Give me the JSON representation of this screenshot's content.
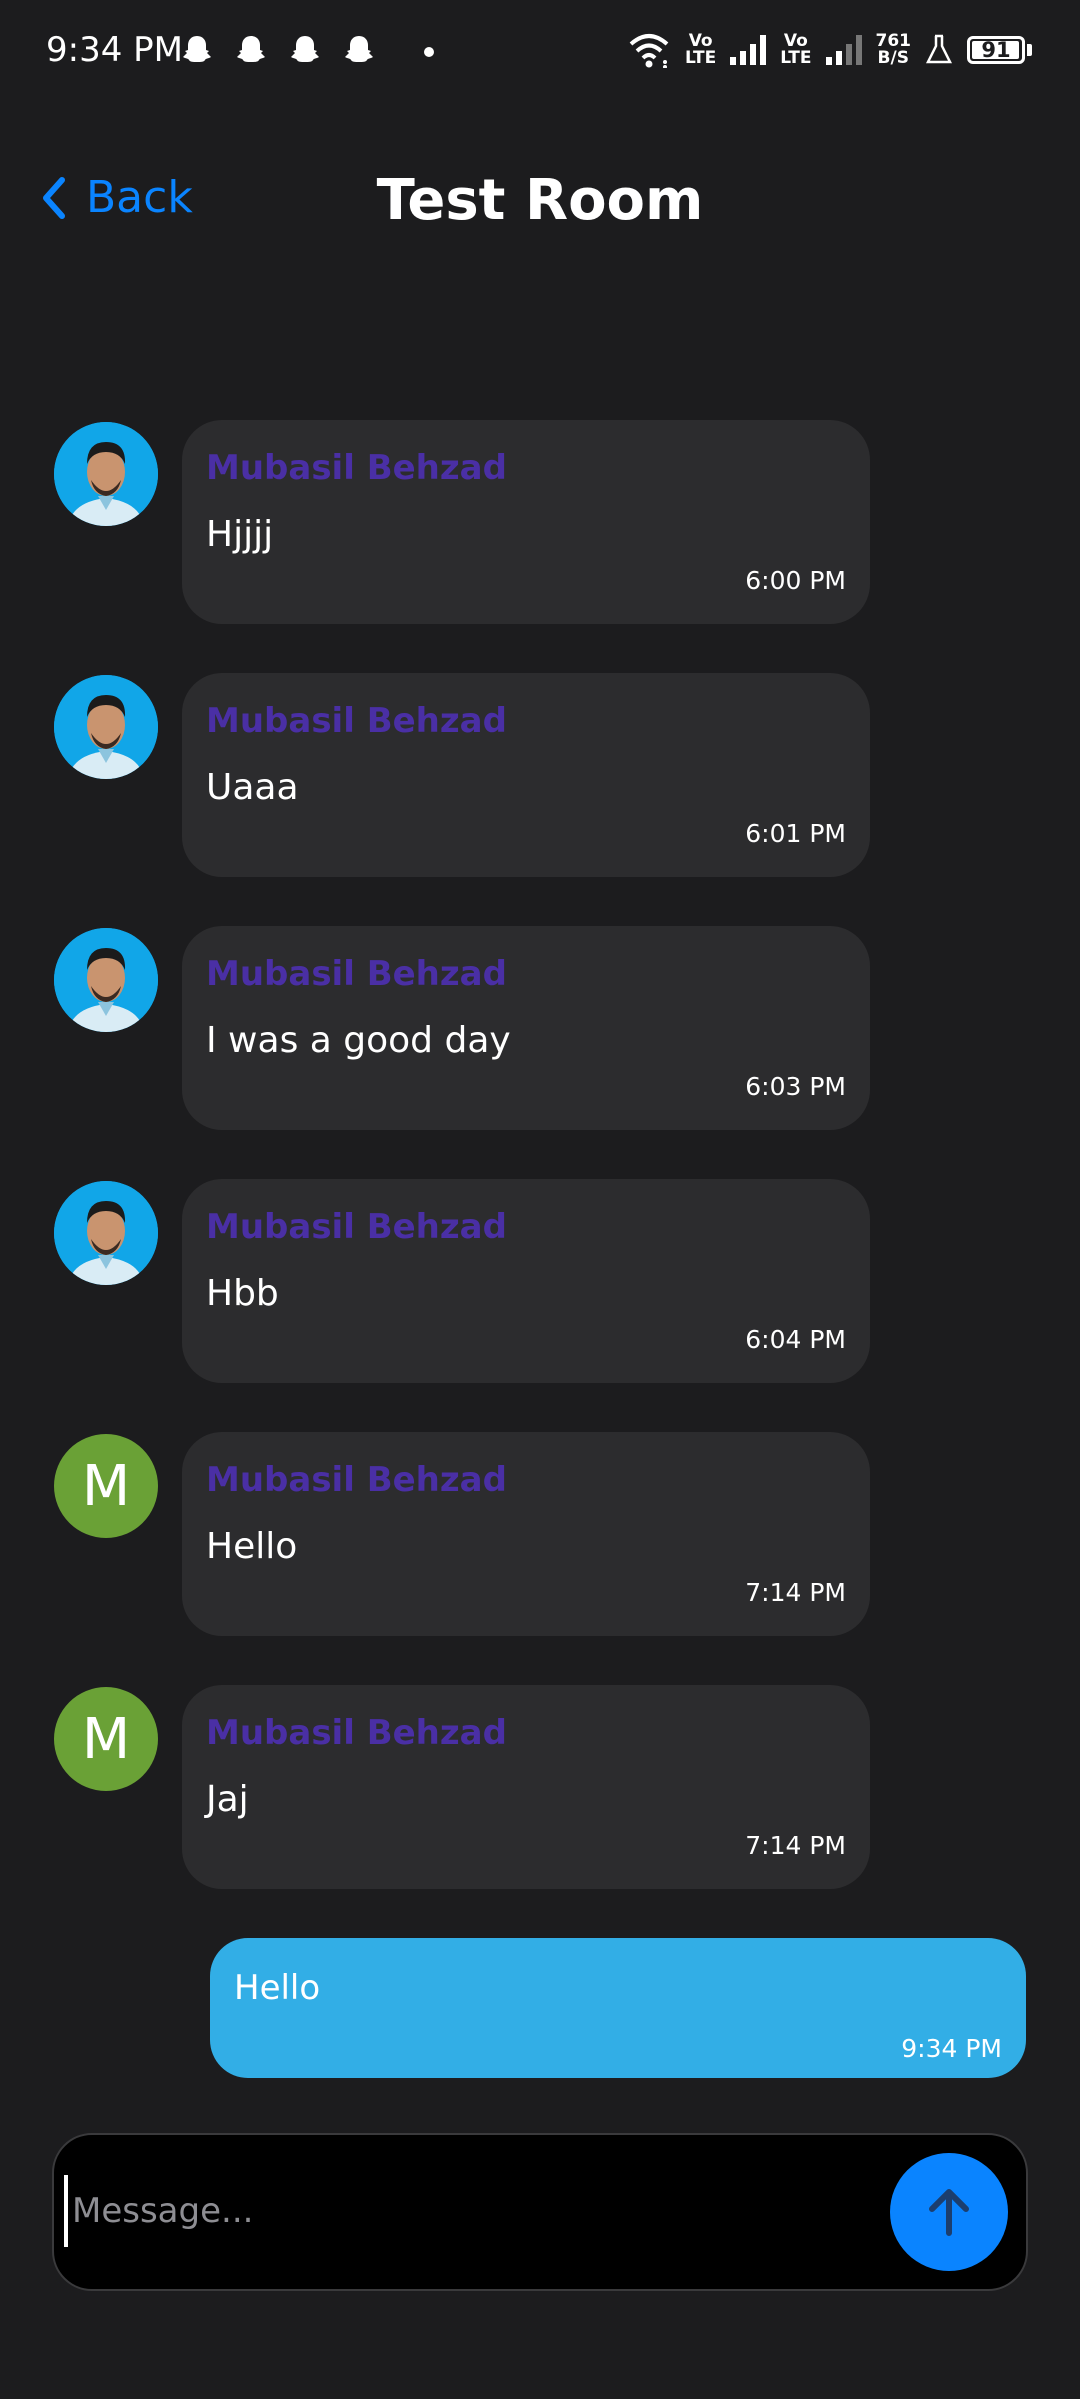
{
  "status_bar": {
    "time": "9:34 PM",
    "volte1_top": "Vo",
    "volte1_bottom": "LTE",
    "volte2_top": "Vo",
    "volte2_bottom": "LTE",
    "net_speed_value": "761",
    "net_speed_unit": "B/S",
    "battery_level": "91",
    "notification_icons": [
      "snapchat-ghost-icon",
      "snapchat-ghost-icon",
      "snapchat-ghost-icon",
      "snapchat-ghost-icon"
    ]
  },
  "header": {
    "back_label": "Back",
    "title": "Test Room"
  },
  "messages": [
    {
      "sender": "Mubasil Behzad",
      "text": "Hjjjj",
      "time": "6:00 PM",
      "avatar": "photo"
    },
    {
      "sender": "Mubasil Behzad",
      "text": "Uaaa",
      "time": "6:01 PM",
      "avatar": "photo"
    },
    {
      "sender": "Mubasil Behzad",
      "text": "I was a good day",
      "time": "6:03 PM",
      "avatar": "photo"
    },
    {
      "sender": "Mubasil Behzad",
      "text": "Hbb",
      "time": "6:04 PM",
      "avatar": "photo"
    },
    {
      "sender": "Mubasil Behzad",
      "text": "Hello",
      "time": "7:14 PM",
      "avatar": "letter",
      "avatar_letter": "M"
    },
    {
      "sender": "Mubasil Behzad",
      "text": "Jaj",
      "time": "7:14 PM",
      "avatar": "letter",
      "avatar_letter": "M"
    }
  ],
  "own_message": {
    "text": "Hello",
    "time": "9:34 PM"
  },
  "composer": {
    "placeholder": "Message...",
    "value": ""
  },
  "colors": {
    "background": "#1c1c1e",
    "accent": "#0a84ff",
    "bubble": "#2c2c2e",
    "own_bubble": "#32aee6",
    "sender_name": "#4a2fa5",
    "letter_avatar": "#6aa136"
  }
}
